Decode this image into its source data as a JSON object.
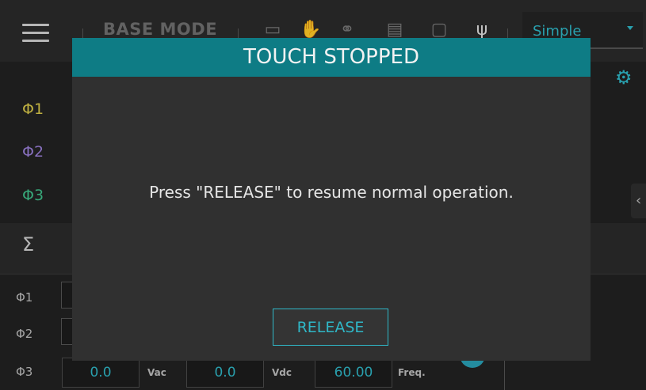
{
  "header": {
    "mode_label": "BASE MODE",
    "dropdown_value": "Simple",
    "icons": [
      "image-icon",
      "touch-icon",
      "network-icon",
      "serial-port-icon",
      "monitor-icon",
      "usb-icon"
    ]
  },
  "phases": {
    "top": [
      "Φ1",
      "Φ2",
      "Φ3"
    ],
    "top_colors": [
      "#d9c84a",
      "#9a7fd8",
      "#3fbf8a"
    ],
    "sigma": "Σ",
    "bottom": [
      "Φ1",
      "Φ2",
      "Φ3"
    ]
  },
  "bottom_row": {
    "vac_value": "0.0",
    "vac_unit": "Vac",
    "vdc_value": "0.0",
    "vdc_unit": "Vdc",
    "freq_value": "60.00",
    "freq_unit": "Freq."
  },
  "dialog": {
    "title": "TOUCH STOPPED",
    "message": "Press \"RELEASE\" to resume normal operation.",
    "button": "RELEASE"
  }
}
